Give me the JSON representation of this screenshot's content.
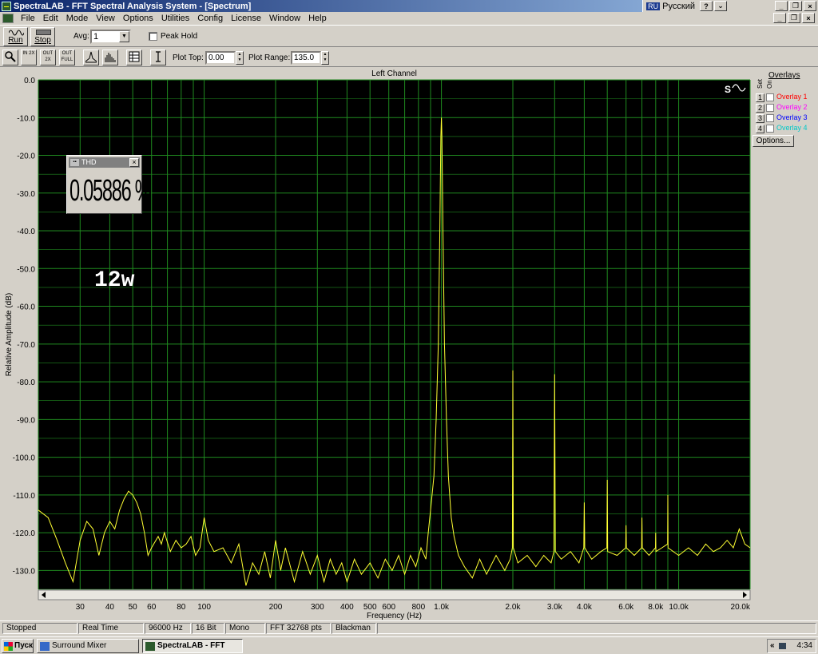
{
  "window": {
    "title": "SpectraLAB - FFT Spectral Analysis System - [Spectrum]",
    "lang_code": "RU",
    "lang_name": "Русский",
    "help_glyph": "?",
    "collapse_glyph": "⌄",
    "minimize_glyph": "_",
    "restore_glyph": "❐",
    "close_glyph": "×"
  },
  "menu": [
    "File",
    "Edit",
    "Mode",
    "View",
    "Options",
    "Utilities",
    "Config",
    "License",
    "Window",
    "Help"
  ],
  "toolbar": {
    "run_label": "Run",
    "stop_label": "Stop",
    "avg_label": "Avg:",
    "avg_value": "1",
    "peak_hold_label": "Peak Hold",
    "peak_hold_checked": false,
    "zoom_buttons": [
      "IN 2X",
      "OUT 2X",
      "OUT FULL"
    ],
    "plot_top_label": "Plot Top:",
    "plot_top_value": "0.00",
    "plot_range_label": "Plot Range:",
    "plot_range_value": "135.0"
  },
  "overlays": {
    "title": "Overlays",
    "col_set": "Set",
    "col_on": "On",
    "items": [
      {
        "num": "1",
        "label": "Overlay 1",
        "color": "#ff0000"
      },
      {
        "num": "2",
        "label": "Overlay 2",
        "color": "#ff00ff"
      },
      {
        "num": "3",
        "label": "Overlay 3",
        "color": "#0000ff"
      },
      {
        "num": "4",
        "label": "Overlay 4",
        "color": "#00ffff"
      }
    ],
    "options_label": "Options..."
  },
  "thd": {
    "title": "THD",
    "value": "0.05886 %"
  },
  "annotation": "12w",
  "chart_data": {
    "type": "line",
    "title": "Left Channel",
    "xlabel": "Frequency (Hz)",
    "ylabel": "Relative Amplitude (dB)",
    "x_scale": "log",
    "xlim": [
      20,
      20000
    ],
    "ylim": [
      -135,
      0
    ],
    "grid": true,
    "background": "#000000",
    "grid_color": "#1f8a1f",
    "line_color": "#ffff33",
    "y_ticks": [
      "0.0",
      "-10.0",
      "-20.0",
      "-30.0",
      "-40.0",
      "-50.0",
      "-60.0",
      "-70.0",
      "-80.0",
      "-90.0",
      "-100.0",
      "-110.0",
      "-120.0",
      "-130.0"
    ],
    "x_ticks": [
      {
        "v": 30,
        "label": "30"
      },
      {
        "v": 40,
        "label": "40"
      },
      {
        "v": 50,
        "label": "50"
      },
      {
        "v": 60,
        "label": "60"
      },
      {
        "v": 80,
        "label": "80"
      },
      {
        "v": 100,
        "label": "100"
      },
      {
        "v": 200,
        "label": "200"
      },
      {
        "v": 300,
        "label": "300"
      },
      {
        "v": 400,
        "label": "400"
      },
      {
        "v": 500,
        "label": "500"
      },
      {
        "v": 600,
        "label": "600"
      },
      {
        "v": 800,
        "label": "800"
      },
      {
        "v": 1000,
        "label": "1.0k"
      },
      {
        "v": 2000,
        "label": "2.0k"
      },
      {
        "v": 3000,
        "label": "3.0k"
      },
      {
        "v": 4000,
        "label": "4.0k"
      },
      {
        "v": 6000,
        "label": "6.0k"
      },
      {
        "v": 8000,
        "label": "8.0k"
      },
      {
        "v": 10000,
        "label": "10.0k"
      },
      {
        "v": 20000,
        "label": "20.0k"
      }
    ],
    "series": [
      {
        "values": [
          [
            20,
            -114
          ],
          [
            22,
            -116
          ],
          [
            24,
            -122
          ],
          [
            26,
            -128
          ],
          [
            28,
            -133
          ],
          [
            30,
            -122
          ],
          [
            32,
            -117
          ],
          [
            34,
            -119
          ],
          [
            36,
            -126
          ],
          [
            38,
            -120
          ],
          [
            40,
            -117
          ],
          [
            42,
            -119
          ],
          [
            44,
            -114
          ],
          [
            46,
            -111
          ],
          [
            48,
            -109
          ],
          [
            50,
            -110
          ],
          [
            52,
            -112
          ],
          [
            54,
            -115
          ],
          [
            56,
            -120
          ],
          [
            58,
            -126
          ],
          [
            60,
            -124
          ],
          [
            64,
            -121
          ],
          [
            66,
            -123
          ],
          [
            68,
            -120
          ],
          [
            72,
            -125
          ],
          [
            76,
            -122
          ],
          [
            80,
            -124
          ],
          [
            84,
            -123
          ],
          [
            88,
            -121
          ],
          [
            92,
            -126
          ],
          [
            96,
            -124
          ],
          [
            100,
            -116
          ],
          [
            104,
            -122
          ],
          [
            110,
            -125
          ],
          [
            120,
            -124
          ],
          [
            130,
            -128
          ],
          [
            140,
            -123
          ],
          [
            150,
            -134
          ],
          [
            160,
            -128
          ],
          [
            170,
            -131
          ],
          [
            180,
            -125
          ],
          [
            190,
            -132
          ],
          [
            200,
            -122
          ],
          [
            210,
            -130
          ],
          [
            220,
            -124
          ],
          [
            240,
            -133
          ],
          [
            260,
            -125
          ],
          [
            280,
            -131
          ],
          [
            300,
            -126
          ],
          [
            320,
            -133
          ],
          [
            340,
            -127
          ],
          [
            360,
            -131
          ],
          [
            380,
            -128
          ],
          [
            400,
            -133
          ],
          [
            430,
            -127
          ],
          [
            460,
            -131
          ],
          [
            500,
            -128
          ],
          [
            540,
            -132
          ],
          [
            580,
            -127
          ],
          [
            620,
            -130
          ],
          [
            660,
            -126
          ],
          [
            700,
            -131
          ],
          [
            740,
            -126
          ],
          [
            780,
            -129
          ],
          [
            820,
            -124
          ],
          [
            860,
            -127
          ],
          [
            880,
            -120
          ],
          [
            900,
            -114
          ],
          [
            930,
            -105
          ],
          [
            950,
            -90
          ],
          [
            970,
            -70
          ],
          [
            985,
            -40
          ],
          [
            995,
            -15
          ],
          [
            1000,
            -10
          ],
          [
            1005,
            -15
          ],
          [
            1015,
            -40
          ],
          [
            1030,
            -70
          ],
          [
            1050,
            -90
          ],
          [
            1070,
            -105
          ],
          [
            1100,
            -116
          ],
          [
            1130,
            -121
          ],
          [
            1180,
            -126
          ],
          [
            1250,
            -129
          ],
          [
            1350,
            -132
          ],
          [
            1450,
            -127
          ],
          [
            1550,
            -131
          ],
          [
            1700,
            -126
          ],
          [
            1850,
            -130
          ],
          [
            1950,
            -127
          ],
          [
            1990,
            -124
          ],
          [
            2000,
            -77
          ],
          [
            2010,
            -124
          ],
          [
            2100,
            -128
          ],
          [
            2300,
            -126
          ],
          [
            2500,
            -129
          ],
          [
            2700,
            -126
          ],
          [
            2900,
            -128
          ],
          [
            2980,
            -125
          ],
          [
            3000,
            -78
          ],
          [
            3020,
            -125
          ],
          [
            3200,
            -127
          ],
          [
            3500,
            -125
          ],
          [
            3800,
            -128
          ],
          [
            3980,
            -124
          ],
          [
            4000,
            -112
          ],
          [
            4020,
            -124
          ],
          [
            4300,
            -127
          ],
          [
            4700,
            -125
          ],
          [
            4980,
            -124
          ],
          [
            5000,
            -106
          ],
          [
            5020,
            -125
          ],
          [
            5500,
            -126
          ],
          [
            5980,
            -124
          ],
          [
            6000,
            -118
          ],
          [
            6020,
            -124
          ],
          [
            6500,
            -126
          ],
          [
            6980,
            -124
          ],
          [
            7000,
            -116
          ],
          [
            7020,
            -124
          ],
          [
            7500,
            -126
          ],
          [
            7980,
            -124
          ],
          [
            8000,
            -120
          ],
          [
            8020,
            -125
          ],
          [
            8500,
            -124
          ],
          [
            8980,
            -123
          ],
          [
            9000,
            -110
          ],
          [
            9020,
            -124
          ],
          [
            10000,
            -126
          ],
          [
            11000,
            -124
          ],
          [
            12000,
            -126
          ],
          [
            13000,
            -123
          ],
          [
            14000,
            -125
          ],
          [
            15000,
            -124
          ],
          [
            16000,
            -122
          ],
          [
            17000,
            -124
          ],
          [
            18000,
            -119
          ],
          [
            19000,
            -123
          ],
          [
            20000,
            -124
          ]
        ]
      }
    ]
  },
  "status": [
    "Stopped",
    "Real Time",
    "96000 Hz",
    "16 Bit",
    "Mono",
    "FFT 32768 pts",
    "Blackman"
  ],
  "taskbar": {
    "start_label": "Пуск",
    "tasks": [
      "Surround Mixer",
      "SpectraLAB - FFT Spe..."
    ],
    "tray_chevron": "«",
    "clock": "4:34"
  }
}
